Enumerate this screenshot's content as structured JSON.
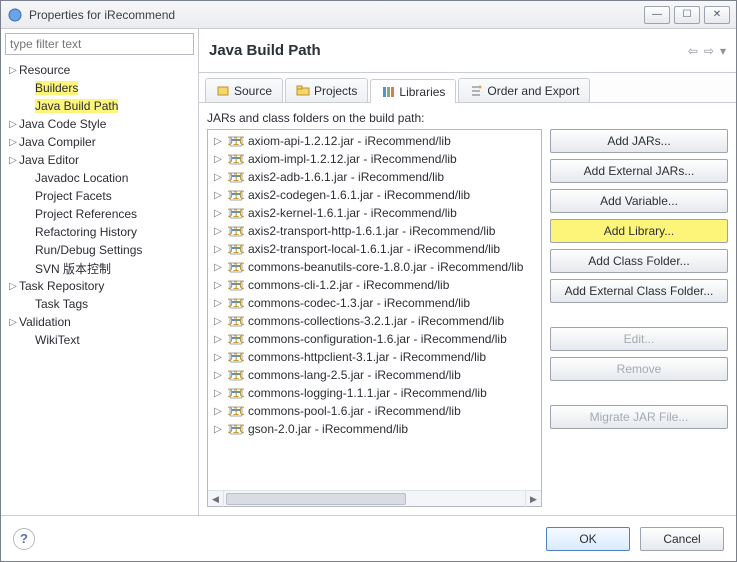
{
  "window": {
    "title": "Properties for iRecommend"
  },
  "filter_placeholder": "type filter text",
  "sidebar": {
    "items": [
      {
        "label": "Resource",
        "expandable": true
      },
      {
        "label": "Builders",
        "highlight": true
      },
      {
        "label": "Java Build Path",
        "highlight": true,
        "selected": true
      },
      {
        "label": "Java Code Style",
        "expandable": true
      },
      {
        "label": "Java Compiler",
        "expandable": true
      },
      {
        "label": "Java Editor",
        "expandable": true
      },
      {
        "label": "Javadoc Location"
      },
      {
        "label": "Project Facets"
      },
      {
        "label": "Project References"
      },
      {
        "label": "Refactoring History"
      },
      {
        "label": "Run/Debug Settings"
      },
      {
        "label": "SVN 版本控制"
      },
      {
        "label": "Task Repository",
        "expandable": true
      },
      {
        "label": "Task Tags"
      },
      {
        "label": "Validation",
        "expandable": true
      },
      {
        "label": "WikiText"
      }
    ]
  },
  "header": {
    "title": "Java Build Path"
  },
  "tabs": [
    {
      "label": "Source",
      "icon": "source"
    },
    {
      "label": "Projects",
      "icon": "projects"
    },
    {
      "label": "Libraries",
      "icon": "libraries",
      "selected": true
    },
    {
      "label": "Order and Export",
      "icon": "order"
    }
  ],
  "list_label": "JARs and class folders on the build path:",
  "jars": [
    "axiom-api-1.2.12.jar - iRecommend/lib",
    "axiom-impl-1.2.12.jar - iRecommend/lib",
    "axis2-adb-1.6.1.jar - iRecommend/lib",
    "axis2-codegen-1.6.1.jar - iRecommend/lib",
    "axis2-kernel-1.6.1.jar - iRecommend/lib",
    "axis2-transport-http-1.6.1.jar - iRecommend/lib",
    "axis2-transport-local-1.6.1.jar - iRecommend/lib",
    "commons-beanutils-core-1.8.0.jar - iRecommend/lib",
    "commons-cli-1.2.jar - iRecommend/lib",
    "commons-codec-1.3.jar - iRecommend/lib",
    "commons-collections-3.2.1.jar - iRecommend/lib",
    "commons-configuration-1.6.jar - iRecommend/lib",
    "commons-httpclient-3.1.jar - iRecommend/lib",
    "commons-lang-2.5.jar - iRecommend/lib",
    "commons-logging-1.1.1.jar - iRecommend/lib",
    "commons-pool-1.6.jar - iRecommend/lib",
    "gson-2.0.jar - iRecommend/lib"
  ],
  "buttons": {
    "add_jars": "Add JARs...",
    "add_ext_jars": "Add External JARs...",
    "add_variable": "Add Variable...",
    "add_library": "Add Library...",
    "add_class_folder": "Add Class Folder...",
    "add_ext_class_folder": "Add External Class Folder...",
    "edit": "Edit...",
    "remove": "Remove",
    "migrate": "Migrate JAR File..."
  },
  "footer": {
    "ok": "OK",
    "cancel": "Cancel"
  }
}
